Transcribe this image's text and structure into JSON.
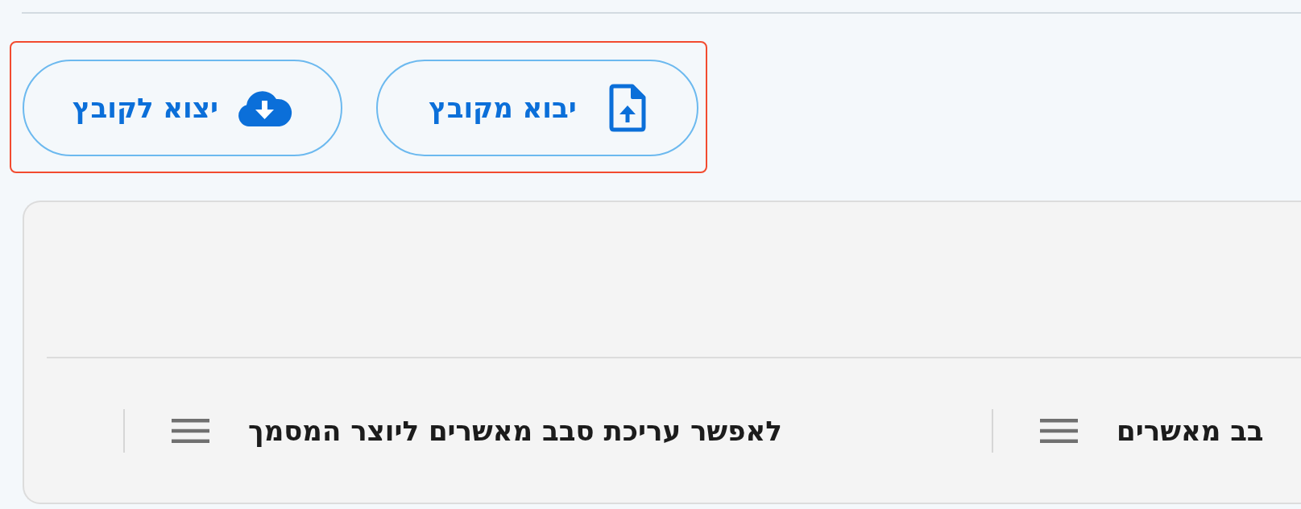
{
  "toolbar": {
    "highlighted": true,
    "buttons": [
      {
        "kind": "import",
        "label": "יבוא מקובץ"
      },
      {
        "kind": "export",
        "label": "יצוא לקובץ"
      }
    ]
  },
  "table": {
    "columns": [
      {
        "label": "בב מאשרים"
      },
      {
        "label": "לאפשר עריכת סבב מאשרים ליוצר המסמך"
      }
    ]
  }
}
